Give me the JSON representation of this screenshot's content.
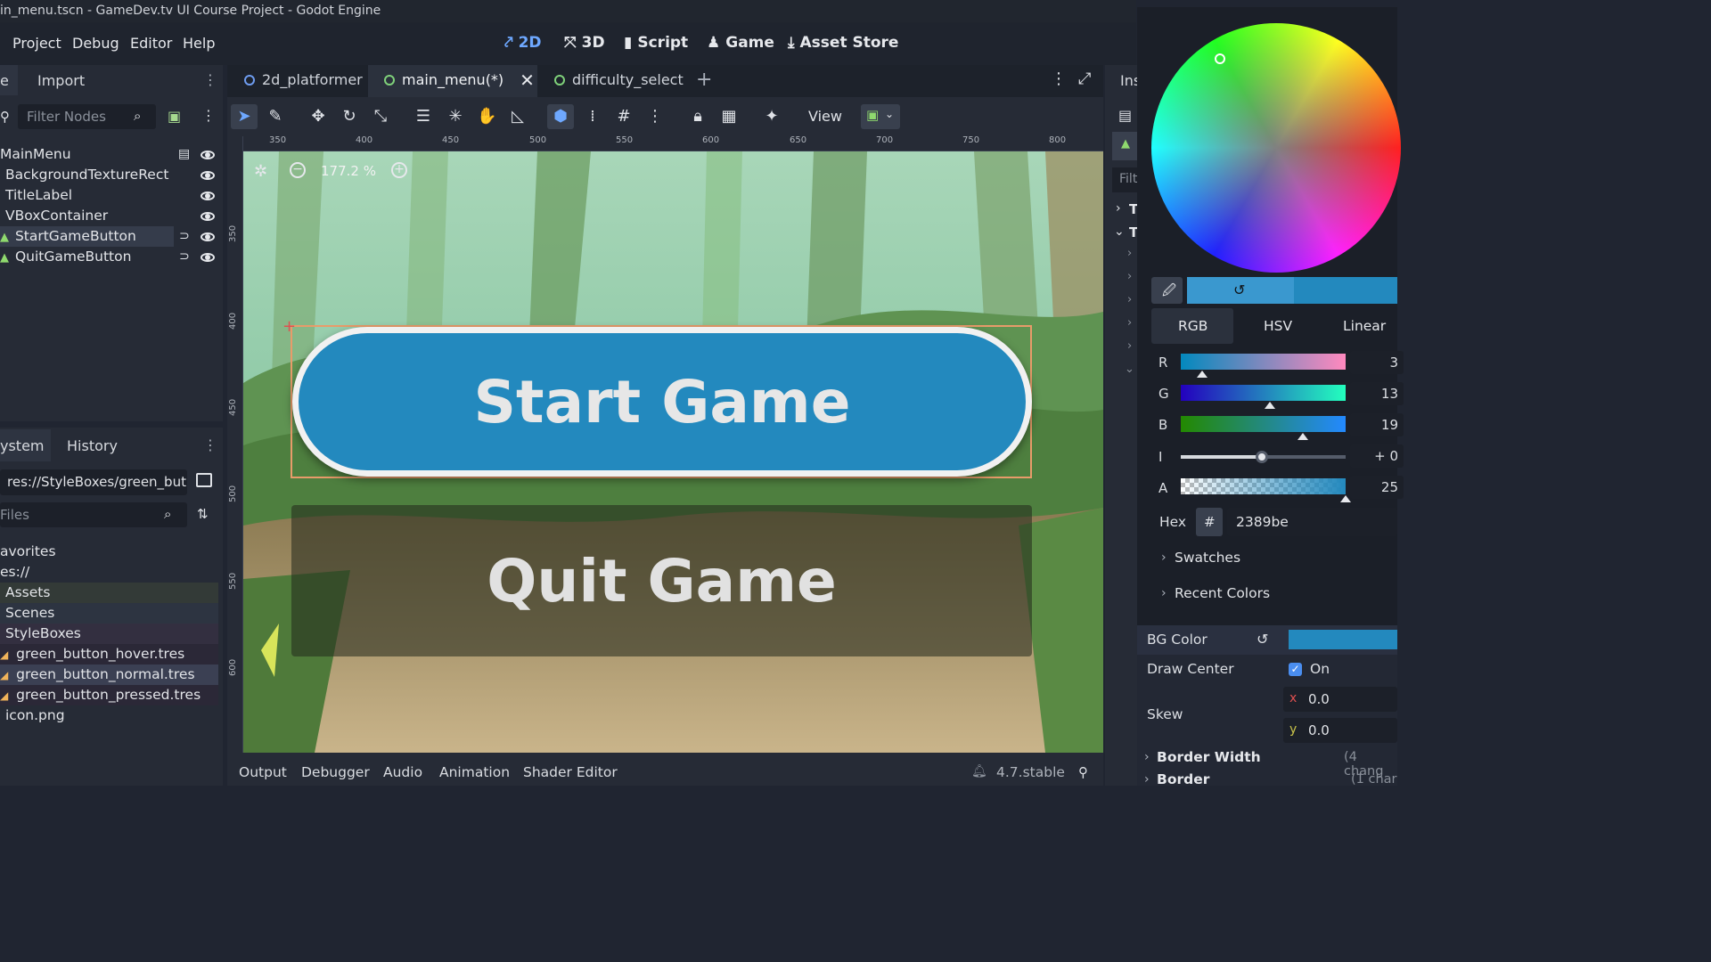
{
  "window": {
    "title": "in_menu.tscn - GameDev.tv UI Course Project - Godot Engine"
  },
  "menu": [
    "Project",
    "Debug",
    "Editor",
    "Help"
  ],
  "workspaces": [
    {
      "label": "2D",
      "icon": "2d-icon"
    },
    {
      "label": "3D",
      "icon": "3d-icon"
    },
    {
      "label": "Script",
      "icon": "script-icon"
    },
    {
      "label": "Game",
      "icon": "game-icon"
    },
    {
      "label": "Asset Store",
      "icon": "asset-store-icon"
    }
  ],
  "scene_dock": {
    "tab_partial": "e",
    "tab_import": "Import",
    "filter_placeholder": "Filter Nodes",
    "nodes": [
      {
        "label": "MainMenu"
      },
      {
        "label": "BackgroundTextureRect"
      },
      {
        "label": "TitleLabel"
      },
      {
        "label": "VBoxContainer"
      },
      {
        "label": "StartGameButton"
      },
      {
        "label": "QuitGameButton"
      }
    ]
  },
  "filesystem_dock": {
    "tab_partial": "ystem",
    "tab_history": "History",
    "path": "res://StyleBoxes/green_but",
    "filter_placeholder": "Files",
    "items": [
      {
        "label": "avorites"
      },
      {
        "label": "es://"
      },
      {
        "label": "Assets"
      },
      {
        "label": "Scenes"
      },
      {
        "label": "StyleBoxes"
      },
      {
        "label": "green_button_hover.tres"
      },
      {
        "label": "green_button_normal.tres"
      },
      {
        "label": "green_button_pressed.tres"
      },
      {
        "label": "icon.png"
      }
    ]
  },
  "scene_tabs": [
    {
      "label": "2d_platformer"
    },
    {
      "label": "main_menu(*)"
    },
    {
      "label": "difficulty_select"
    }
  ],
  "toolbar": {
    "view_label": "View"
  },
  "viewport": {
    "zoom": "177.2 %",
    "ruler_h": [
      "350",
      "400",
      "450",
      "500",
      "550",
      "600",
      "650",
      "700",
      "750",
      "800"
    ],
    "ruler_v": [
      "350",
      "400",
      "450",
      "500",
      "550",
      "600"
    ],
    "start_button": "Start Game",
    "quit_button": "Quit Game"
  },
  "bottom_panel": {
    "tabs": [
      "Output",
      "Debugger",
      "Audio",
      "Animation",
      "Shader Editor"
    ],
    "version": "4.7.stable"
  },
  "inspector": {
    "tab_partial": "Ins",
    "filter_partial": "Filt",
    "section_partials": [
      "T",
      "T"
    ]
  },
  "color_picker": {
    "modes": [
      "RGB",
      "HSV",
      "Linear"
    ],
    "channels": [
      {
        "label": "R",
        "value": "3",
        "fraction": 0.13
      },
      {
        "label": "G",
        "value": "13",
        "fraction": 0.54
      },
      {
        "label": "B",
        "value": "19",
        "fraction": 0.74
      },
      {
        "label": "I",
        "value": "+ 0",
        "fraction": 0.5
      },
      {
        "label": "A",
        "value": "25",
        "fraction": 1.0
      }
    ],
    "hex_label": "Hex",
    "hex_prefix": "#",
    "hex_value": "2389be",
    "swatches_label": "Swatches",
    "recent_label": "Recent Colors",
    "current_color": "#2389be"
  },
  "properties": {
    "bg_color_label": "BG Color",
    "draw_center_label": "Draw Center",
    "draw_center_value": "On",
    "skew_label": "Skew",
    "skew_x_label": "x",
    "skew_x": "0.0",
    "skew_y_label": "y",
    "skew_y": "0.0",
    "border_width_label": "Border Width",
    "border_width_note": "(4 chang",
    "border_label": "Border",
    "border_note": "(1 char"
  }
}
